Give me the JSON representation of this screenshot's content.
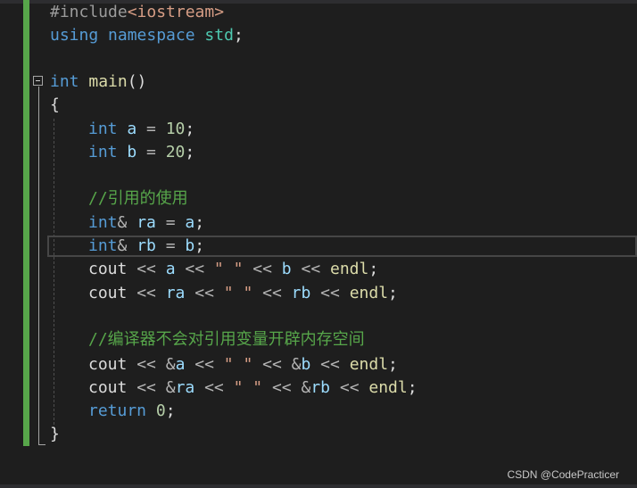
{
  "colors": {
    "background": "#1e1e1e",
    "keyword": "#569cd6",
    "preprocessor": "#9b9b9b",
    "header": "#d69d85",
    "namespace": "#4ec9b0",
    "function": "#dcdcaa",
    "variable": "#9cdcfe",
    "number": "#b5cea8",
    "string": "#d69d85",
    "comment": "#57a64a",
    "change_bar": "#57a64a"
  },
  "code": {
    "l1": [
      "#include",
      "<iostream>"
    ],
    "l2": [
      "using",
      " ",
      "namespace",
      " ",
      "std",
      ";"
    ],
    "l4": [
      "int",
      " ",
      "main",
      "()"
    ],
    "l5": [
      "{"
    ],
    "l6": [
      "int",
      " ",
      "a",
      " = ",
      "10",
      ";"
    ],
    "l7": [
      "int",
      " ",
      "b",
      " = ",
      "20",
      ";"
    ],
    "l9": [
      "//引用的使用"
    ],
    "l10": [
      "int",
      "&",
      " ",
      "ra",
      " = ",
      "a",
      ";"
    ],
    "l11": [
      "int",
      "&",
      " ",
      "rb",
      " = ",
      "b",
      ";"
    ],
    "l12": [
      "cout",
      " << ",
      "a",
      " << ",
      "\" \"",
      " << ",
      "b",
      " << ",
      "endl",
      ";"
    ],
    "l13": [
      "cout",
      " << ",
      "ra",
      " << ",
      "\" \"",
      " << ",
      "rb",
      " << ",
      "endl",
      ";"
    ],
    "l15": [
      "//编译器不会对引用变量开辟内存空间"
    ],
    "l16": [
      "cout",
      " << ",
      "&",
      "a",
      " << ",
      "\" \"",
      " << ",
      "&",
      "b",
      " << ",
      "endl",
      ";"
    ],
    "l17": [
      "cout",
      " << ",
      "&",
      "ra",
      " << ",
      "\" \"",
      " << ",
      "&",
      "rb",
      " << ",
      "endl",
      ";"
    ],
    "l18": [
      "return",
      " ",
      "0",
      ";"
    ],
    "l19": [
      "}"
    ]
  },
  "watermark": "CSDN @CodePracticer"
}
